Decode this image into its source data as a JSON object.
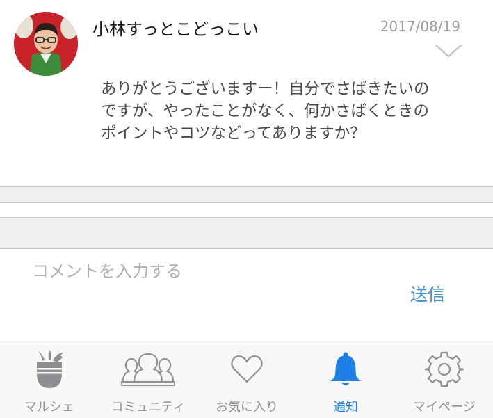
{
  "comment": {
    "username": "小林すっとこどっこい",
    "date": "2017/08/19",
    "avatar_icon": "user-avatar-icon",
    "menu_icon": "chevron-down-icon",
    "message_lines": [
      "ありがとうございますー！自分でさばきたいの",
      "ですが、やったことがなく、何かさばくときの",
      "ポイントやコツなどってありますか？"
    ]
  },
  "composer": {
    "placeholder": "コメントを入力する",
    "send_label": "送信"
  },
  "tabbar": {
    "items": [
      {
        "label": "マルシェ",
        "icon": "vegetable-basket-icon",
        "active": false
      },
      {
        "label": "コミュニティ",
        "icon": "community-people-icon",
        "active": false
      },
      {
        "label": "お気に入り",
        "icon": "heart-icon",
        "active": false
      },
      {
        "label": "通知",
        "icon": "bell-icon",
        "active": true
      },
      {
        "label": "マイページ",
        "icon": "gear-icon",
        "active": false
      }
    ]
  },
  "colors": {
    "accent": "#1e7fe8",
    "send": "#4a90c8",
    "inactive": "#8e8e93",
    "date": "#9a9a9a"
  }
}
